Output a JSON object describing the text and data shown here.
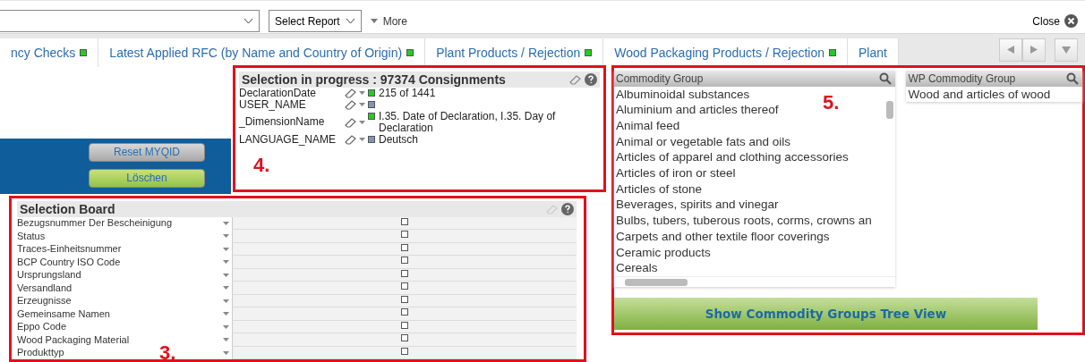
{
  "toolbar": {
    "report_select": "Select Report",
    "more": "More",
    "close": "Close"
  },
  "tabs": [
    {
      "label": "ncy Checks",
      "color": "#22cc22"
    },
    {
      "label": "Latest Applied RFC (by Name and Country of Origin)",
      "color": "#22cc22"
    },
    {
      "label": "Plant Products / Rejection",
      "color": "#22cc22"
    },
    {
      "label": "Wood Packaging Products / Rejection",
      "color": "#22cc22"
    },
    {
      "label": "Plant"
    }
  ],
  "buttons": [
    {
      "label": "Reset MYQID",
      "kind": "grey"
    },
    {
      "label": "Löschen",
      "kind": "green"
    }
  ],
  "selection_in_progress": {
    "title": "Selection in progress : 97374 Consignments",
    "annotation": "4.",
    "rows": [
      {
        "field": "DeclarationDate",
        "value": "215 of 1441",
        "color": "#22cc22"
      },
      {
        "field": "USER_NAME",
        "color": "#7f95b8"
      },
      {
        "field": "_DimensionName",
        "value": "I.35. Date of Declaration, I.35. Day of Declaration",
        "color": "#22cc22"
      },
      {
        "field": "LANGUAGE_NAME",
        "value": "Deutsch",
        "color": "#7f95b8"
      }
    ]
  },
  "selection_board": {
    "title": "Selection Board",
    "annotation": "3.",
    "rows": [
      {
        "label": "Bezugsnummer Der Bescheinigung",
        "checked": false
      },
      {
        "label": "Status",
        "checked": false
      },
      {
        "label": "Traces-Einheitsnummer",
        "checked": false
      },
      {
        "label": "BCP Country ISO Code",
        "checked": false
      },
      {
        "label": "Ursprungsland",
        "checked": false
      },
      {
        "label": "Versandland",
        "checked": false
      },
      {
        "label": "Erzeugnisse",
        "checked": false
      },
      {
        "label": "Gemeinsame Namen",
        "checked": false
      },
      {
        "label": "Eppo Code",
        "checked": false
      },
      {
        "label": "Wood Packaging Material",
        "checked": false
      },
      {
        "label": "Produkttyp",
        "checked": false
      }
    ]
  },
  "commodity": {
    "annotation": "5.",
    "lists": [
      {
        "title": "Commodity Group",
        "items": [
          "Albuminoidal substances",
          "Aluminium and articles thereof",
          "Animal feed",
          "Animal or vegetable fats and oils",
          "Articles of apparel and clothing accessories",
          "Articles of iron or steel",
          "Articles of stone",
          "Beverages, spirits and vinegar",
          "Bulbs, tubers, tuberous roots, corms, crowns an",
          "Carpets and other textile floor coverings",
          "Ceramic products",
          "Cereals"
        ],
        "scrollbars": true
      },
      {
        "title": "WP Commodity Group",
        "items": [
          "Wood and articles of wood"
        ],
        "scrollbars": false
      }
    ],
    "tree_button": "Show Commodity Groups Tree View"
  }
}
